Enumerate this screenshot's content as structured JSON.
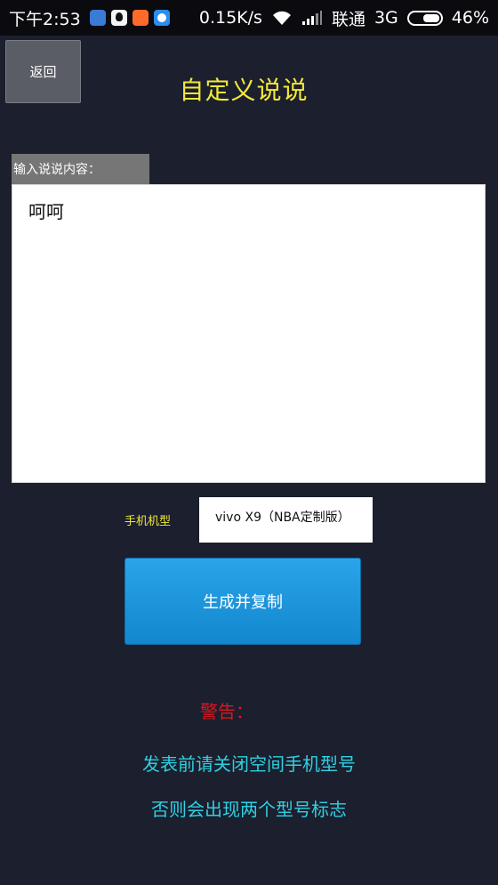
{
  "status_bar": {
    "time": "下午2:53",
    "net_speed": "0.15K/s",
    "carrier": "联通",
    "network": "3G",
    "battery": "46%",
    "icons": [
      "app-icon",
      "qq-icon",
      "mi-icon",
      "message-icon",
      "wifi-icon",
      "signal-icon",
      "battery-icon"
    ]
  },
  "header": {
    "back_label": "返回",
    "title": "自定义说说"
  },
  "form": {
    "content_label": "输入说说内容：",
    "content_value": "呵呵",
    "model_label": "手机机型",
    "model_value": "vivo X9（NBA定制版）",
    "generate_label": "生成并复制"
  },
  "warning": {
    "title": "警告：",
    "line1": "发表前请关闭空间手机型号",
    "line2": "否则会出现两个型号标志"
  },
  "colors": {
    "background": "#1b1f2e",
    "title": "#f3e83a",
    "warning_title": "#e0161c",
    "warning_text": "#2fd0e2",
    "button": "#1a95dd"
  }
}
